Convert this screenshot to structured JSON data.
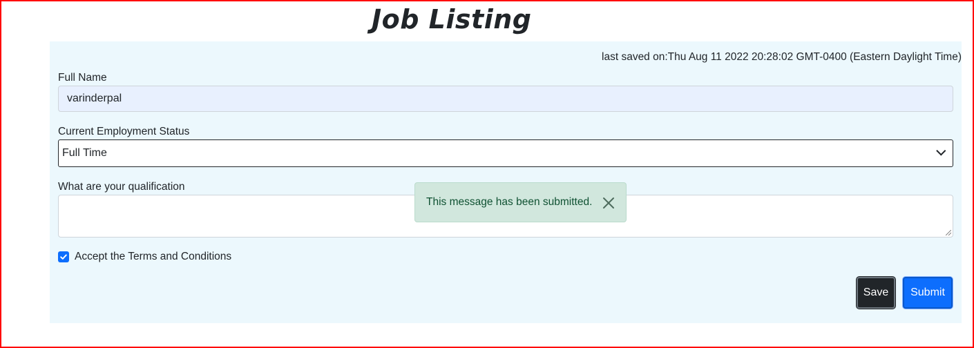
{
  "page": {
    "title": "Job Listing"
  },
  "form": {
    "last_saved": "last saved on:Thu Aug 11 2022 20:28:02 GMT-0400 (Eastern Daylight Time)",
    "full_name": {
      "label": "Full Name",
      "value": "varinderpal"
    },
    "employment_status": {
      "label": "Current Employment Status",
      "selected": "Full Time"
    },
    "qualification": {
      "label": "What are your qualification",
      "value": ""
    },
    "terms": {
      "label": "Accept the Terms and Conditions",
      "checked": true
    },
    "save_label": "Save",
    "submit_label": "Submit"
  },
  "toast": {
    "message": "This message has been submitted.",
    "close_icon": "close-icon"
  },
  "colors": {
    "panel_bg": "#ecf8fd",
    "primary": "#0d6efd",
    "dark": "#212529",
    "success_bg": "#d1e7dd",
    "success_text": "#0f5132",
    "frame_border": "#ff0000"
  }
}
